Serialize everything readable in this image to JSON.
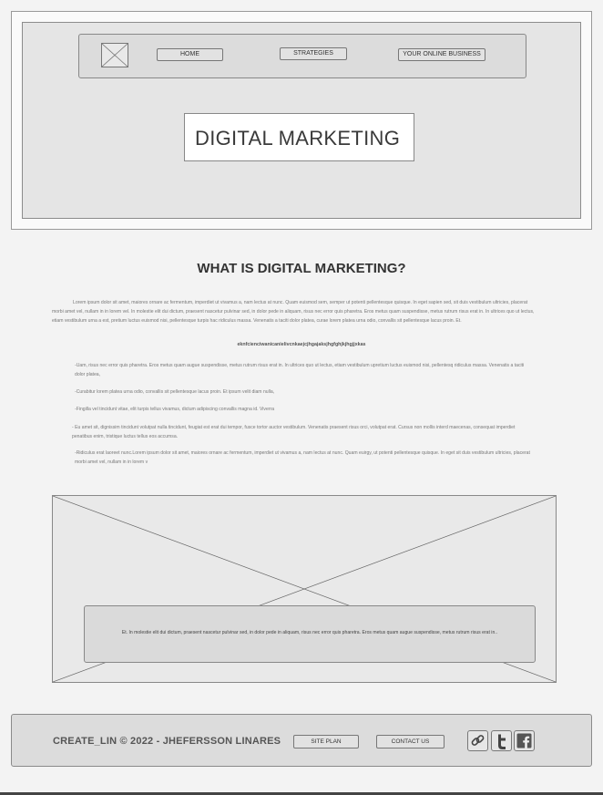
{
  "header": {
    "logo_icon": "image-placeholder-icon",
    "nav": [
      {
        "label": "HOME"
      },
      {
        "label": "STRATEGIES"
      },
      {
        "label": "YOUR ONLINE BUSINESS"
      }
    ],
    "hero_title": "DIGITAL MARKETING"
  },
  "main": {
    "heading": "WHAT IS DIGITAL MARKETING?",
    "intro": "Lorem ipsum dolor sit amet, maiores ornare ac fermentum, imperdiet ut vivamus a, nam lectus at nunc. Quam euismod sem, semper ut potenti pellentesque quisque. In eget sapien sed, sit duis vestibulum ultricies, placerat morbi amet vel, nullam in in lorem vel. In molestie elit dui dictum, praesent nascetur pulvinar sed, in dolor pede in aliquam, risus nec error quis pharetra. Eros metus quam suspendisse, metus rutrum risus erat in.  In ultrices quo ut lectus, etiam vestibulum urna a est, pretium luctus euismod nisi, pellentesque turpis hac ridiculus massa. Venenatis a taciti dolor platea, curae lorem platea urna odio, convallis sit pellentesque lacus proin. Et.",
    "subheading": "eknfcienciwanicanielivcnkaejcjhgajaksjhgfghjkjhgjjxkas",
    "bullets": [
      "-Uam, risus nec error quis pharetra. Eros metus quam augue suspendisse, metus rutrum risus erat in.  In ultrices quo ut lectus, etiam vestibulum upretium luctus euismod nisi, pellentesq ridiculus massa. Venenatis a taciti dolor platea,",
      "-Curabitur lorem platea urna odio, convallis sit pellentesque lacus proin. Et ipsum velit diam nulla,",
      "-Fingilla vel tincidunt vitae, elit turpis tellus vivamus, dictum adipiscing convallis magna id.  Viverra",
      "- Eu amet sit, dignissim tincidunt volutpat nulla tincidunt, feugiat est erat dui tempor, fusce tortor auctor vestibulum. Venenatis praesent risus orci, volutpat erat. Cursus non mollis interd maecenas, consequat imperdiet penatibus enim, tristique luctus tellus eos accumsa.",
      "-Ridiculus erat laoreet nunc.Lorem ipsum dolor sit amet, maiores ornare ac fermentum, imperdiet ut vivamus a, nam lectus at nunc. Quam euirgy,  ut potenti pellentesque quisque. In eget sit duis vestibulum ultricies, placerat morbi amet vel, nullam in in lorem v"
    ],
    "media_icon": "image-placeholder-icon",
    "caption": "Et. In molestie elit dui dictum, praesent nascetur pulvinar sed, in dolor pede in aliquam, risus nec error quis pharetra. Eros metus quam augue suspendisse, metus rutrum risus erat in.."
  },
  "footer": {
    "copyright": "CREATE_LIN © 2022 - JHEFERSSON LINARES",
    "site_plan": "SITE PLAN",
    "contact": "CONTACT US",
    "social_icons": [
      "link-icon",
      "twitter-icon",
      "facebook-icon"
    ]
  }
}
